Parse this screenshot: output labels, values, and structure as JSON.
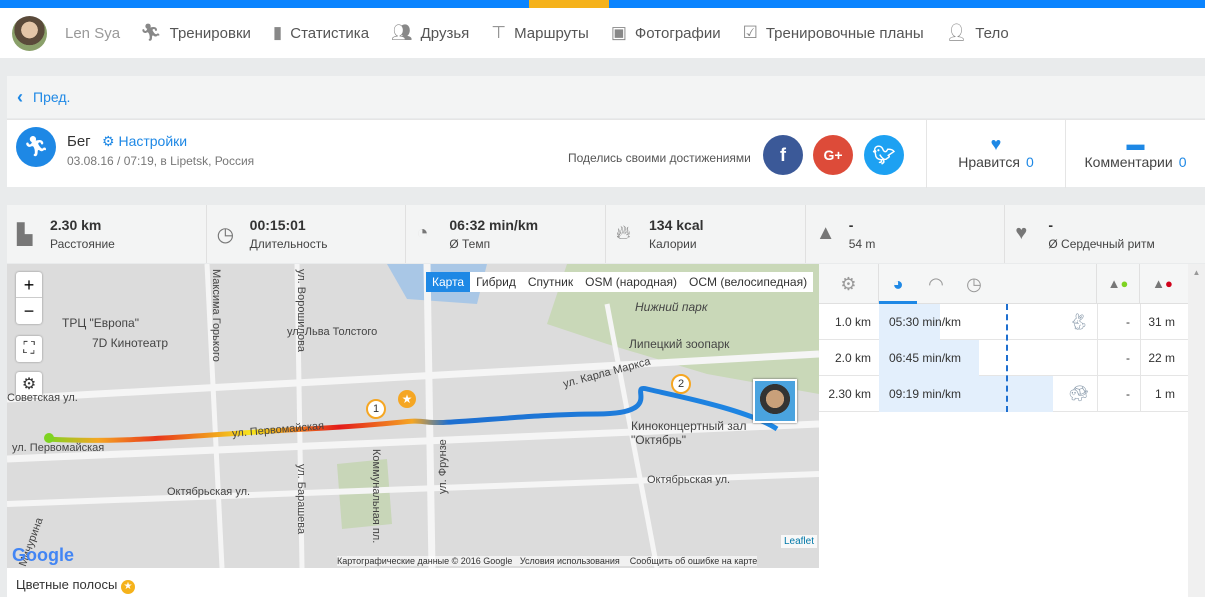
{
  "nav": {
    "user": "Len Sya",
    "items": [
      {
        "label": "Тренировки",
        "icon": "running-icon"
      },
      {
        "label": "Статистика",
        "icon": "bar-chart-icon"
      },
      {
        "label": "Друзья",
        "icon": "friends-icon"
      },
      {
        "label": "Маршруты",
        "icon": "signpost-icon"
      },
      {
        "label": "Фотографии",
        "icon": "camera-icon"
      },
      {
        "label": "Тренировочные планы",
        "icon": "clipboard-icon"
      },
      {
        "label": "Тело",
        "icon": "person-icon"
      }
    ]
  },
  "back": "Пред.",
  "workout": {
    "sport": "Бег",
    "settings": "Настройки",
    "date": "03.08.16 / 07:19, в Lipetsk, Россия",
    "share": "Поделись своими достижениями",
    "likes_label": "Нравится",
    "likes": "0",
    "comments_label": "Комментарии",
    "comments": "0"
  },
  "stats": [
    {
      "value": "2.30 km",
      "label": "Расстояние"
    },
    {
      "value": "00:15:01",
      "label": "Длительность"
    },
    {
      "value": "06:32 min/km",
      "label": "Ø Темп"
    },
    {
      "value": "134 kcal",
      "label": "Калории"
    },
    {
      "value": "-",
      "label": "54 m"
    },
    {
      "value": "-",
      "label": "Ø Сердечный ритм"
    }
  ],
  "map": {
    "layers": [
      "Карта",
      "Гибрид",
      "Спутник",
      "OSM (народная)",
      "OCM (велосипедная)"
    ],
    "active_layer": "Карта",
    "labels": [
      "ТРЦ \"Европа\"",
      "7D Кинотеатр",
      "Советская ул.",
      "ул. Первомайская",
      "ул. Первомайская",
      "Октябрьская ул.",
      "Нижний парк",
      "Липецкий зоопарк",
      "ул. Карла Маркса",
      "Киноконцертный зал \"Октябрь\"",
      "Октябрьская ул.",
      "ул. Льва Толстого",
      "ул. Ворошилова",
      "Максима Горького",
      "Коммунальная пл.",
      "ул. Фрунзе",
      "ул. Барашева",
      "Мичурина"
    ],
    "markers": [
      "1",
      "2"
    ],
    "credits": "Картографические данные © 2016 Google",
    "terms": "Условия использования",
    "report": "Сообщить об ошибке на карте",
    "leaflet": "Leaflet",
    "google": "Google"
  },
  "bands": "Цветные полосы",
  "splits": {
    "rows": [
      {
        "dist": "1.0 km",
        "pace": "05:30 min/km",
        "fill": 0.28,
        "up": "-",
        "down": "31 m",
        "animal": "rabbit"
      },
      {
        "dist": "2.0 km",
        "pace": "06:45 min/km",
        "fill": 0.46,
        "up": "-",
        "down": "22 m",
        "animal": ""
      },
      {
        "dist": "2.30 km",
        "pace": "09:19 min/km",
        "fill": 0.8,
        "up": "-",
        "down": "1 m",
        "animal": "turtle"
      }
    ]
  }
}
